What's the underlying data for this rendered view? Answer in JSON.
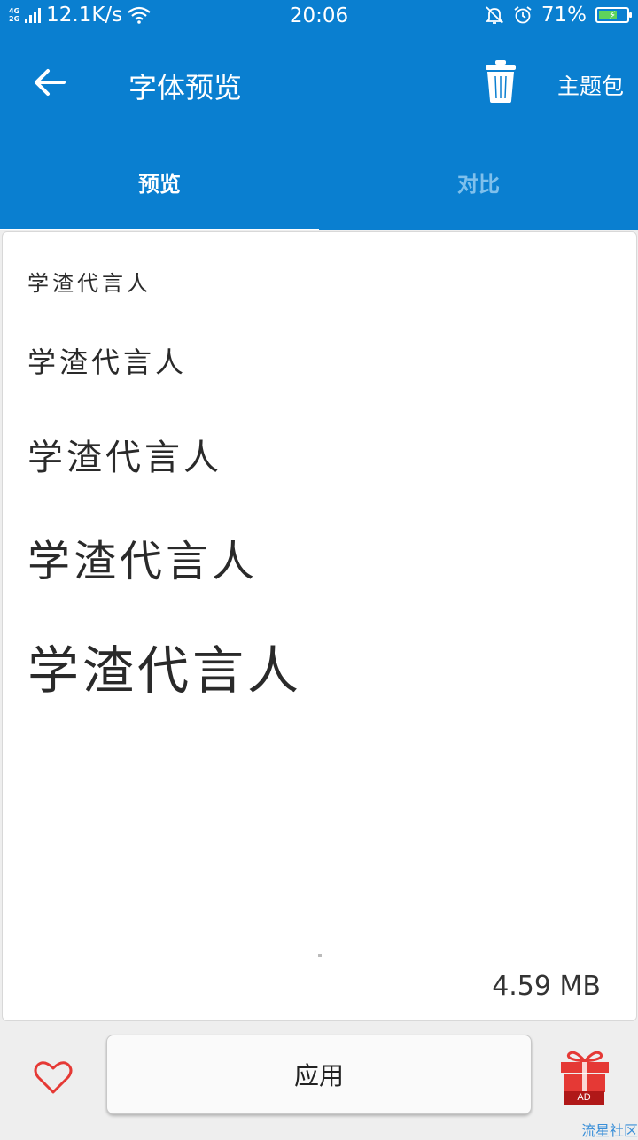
{
  "status_bar": {
    "network_type": [
      "4G",
      "2G"
    ],
    "net_speed": "12.1K/s",
    "time": "20:06",
    "battery": "71%",
    "battery_level": 0.71,
    "icons": [
      "signal-icon",
      "wifi-icon",
      "mute-icon",
      "alarm-icon",
      "battery-icon"
    ]
  },
  "app_bar": {
    "title": "字体预览",
    "theme_label": "主题包",
    "icons": [
      "back-arrow-icon",
      "trash-icon"
    ]
  },
  "tabs": [
    {
      "label": "预览",
      "active": true
    },
    {
      "label": "对比",
      "active": false
    }
  ],
  "preview": {
    "samples": [
      "学渣代言人",
      "学渣代言人",
      "学渣代言人",
      "学渣代言人",
      "学渣代言人"
    ],
    "file_size": "4.59 MB"
  },
  "bottom_bar": {
    "apply_label": "应用",
    "ad_label": "AD",
    "icons": [
      "heart-icon",
      "gift-icon"
    ]
  },
  "watermark": "流星社区",
  "colors": {
    "primary": "#0a7fd0",
    "inactive_tab": "#7fc0ec",
    "heart": "#e53935",
    "gift": "#e53935"
  }
}
